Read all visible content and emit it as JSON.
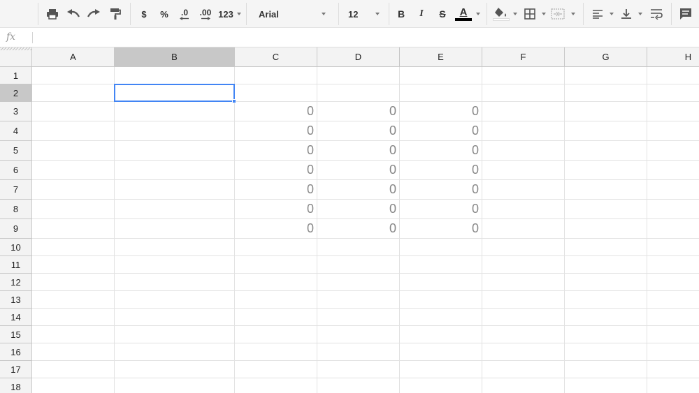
{
  "toolbar": {
    "currency_label": "$",
    "percent_label": "%",
    "decrease_decimal_label": ".0",
    "increase_decimal_label": ".00",
    "more_formats_label": "123",
    "font_name": "Arial",
    "font_size": "12",
    "bold_label": "B",
    "italic_label": "I",
    "strike_label": "S",
    "text_color_label": "A",
    "text_color": "#000000",
    "fill_color": "#ffffff",
    "accent": "#4285f4"
  },
  "formula_bar": {
    "fx_label": "fx",
    "value": ""
  },
  "sheet": {
    "columns": [
      "A",
      "B",
      "C",
      "D",
      "E",
      "F",
      "G",
      "H"
    ],
    "selected_column": "B",
    "rows": [
      "1",
      "2",
      "3",
      "4",
      "5",
      "6",
      "7",
      "8",
      "9",
      "10",
      "11",
      "12",
      "13",
      "14",
      "15",
      "16",
      "17",
      "18"
    ],
    "selected_row": "2",
    "active_cell": "B2",
    "cells": [
      [
        "",
        "",
        "",
        "",
        "",
        "",
        "",
        ""
      ],
      [
        "",
        "",
        "",
        "",
        "",
        "",
        "",
        ""
      ],
      [
        "",
        "",
        "0",
        "0",
        "0",
        "",
        "",
        ""
      ],
      [
        "",
        "",
        "0",
        "0",
        "0",
        "",
        "",
        ""
      ],
      [
        "",
        "",
        "0",
        "0",
        "0",
        "",
        "",
        ""
      ],
      [
        "",
        "",
        "0",
        "0",
        "0",
        "",
        "",
        ""
      ],
      [
        "",
        "",
        "0",
        "0",
        "0",
        "",
        "",
        ""
      ],
      [
        "",
        "",
        "0",
        "0",
        "0",
        "",
        "",
        ""
      ],
      [
        "",
        "",
        "0",
        "0",
        "0",
        "",
        "",
        ""
      ],
      [
        "",
        "",
        "",
        "",
        "",
        "",
        "",
        ""
      ],
      [
        "",
        "",
        "",
        "",
        "",
        "",
        "",
        ""
      ],
      [
        "",
        "",
        "",
        "",
        "",
        "",
        "",
        ""
      ],
      [
        "",
        "",
        "",
        "",
        "",
        "",
        "",
        ""
      ],
      [
        "",
        "",
        "",
        "",
        "",
        "",
        "",
        ""
      ],
      [
        "",
        "",
        "",
        "",
        "",
        "",
        "",
        ""
      ],
      [
        "",
        "",
        "",
        "",
        "",
        "",
        "",
        ""
      ],
      [
        "",
        "",
        "",
        "",
        "",
        "",
        "",
        ""
      ],
      [
        "",
        "",
        "",
        "",
        "",
        "",
        "",
        ""
      ]
    ]
  }
}
